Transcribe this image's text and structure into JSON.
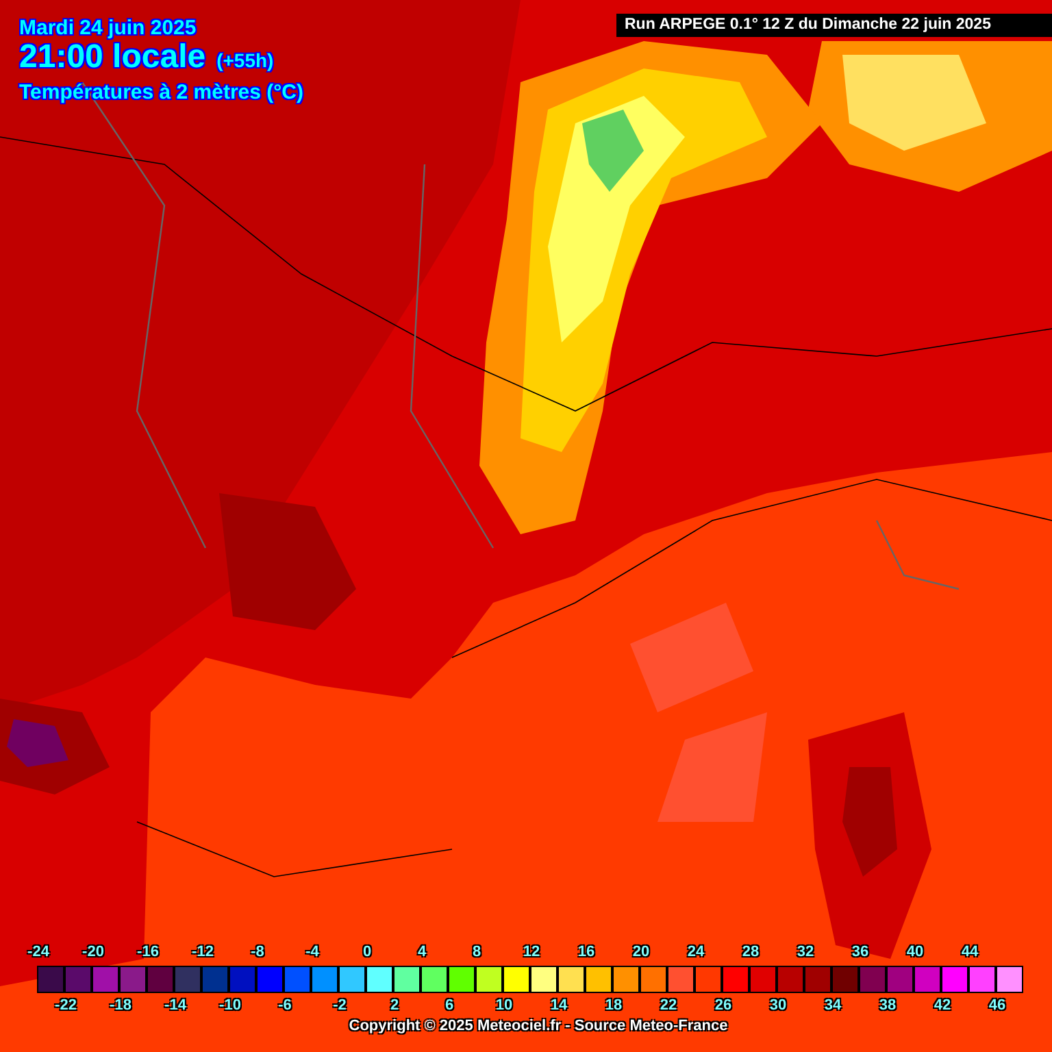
{
  "header": {
    "date": "Mardi 24 juin 2025",
    "time": "21:00 locale",
    "lead": "(+55h)",
    "field": "Températures à 2 mètres (°C)"
  },
  "run_banner": "Run ARPEGE 0.1° 12 Z du Dimanche 22 juin 2025",
  "legend": [
    {
      "label": "-24",
      "color": "#3a0a4a"
    },
    {
      "label": "-22",
      "color": "#5a0a6a"
    },
    {
      "label": "-20",
      "color": "#a010a8"
    },
    {
      "label": "-18",
      "color": "#8a1a8a"
    },
    {
      "label": "-16",
      "color": "#600040"
    },
    {
      "label": "-14",
      "color": "#303060"
    },
    {
      "label": "-12",
      "color": "#003090"
    },
    {
      "label": "-10",
      "color": "#0010c0"
    },
    {
      "label": "-8",
      "color": "#0000ff"
    },
    {
      "label": "-6",
      "color": "#0050ff"
    },
    {
      "label": "-4",
      "color": "#0090ff"
    },
    {
      "label": "-2",
      "color": "#30c8ff"
    },
    {
      "label": "0",
      "color": "#60ffff"
    },
    {
      "label": "2",
      "color": "#60ffa0"
    },
    {
      "label": "4",
      "color": "#60ff60"
    },
    {
      "label": "6",
      "color": "#60ff00"
    },
    {
      "label": "8",
      "color": "#c0ff20"
    },
    {
      "label": "10",
      "color": "#ffff00"
    },
    {
      "label": "12",
      "color": "#ffff80"
    },
    {
      "label": "14",
      "color": "#ffe050"
    },
    {
      "label": "16",
      "color": "#ffc000"
    },
    {
      "label": "18",
      "color": "#ff9000"
    },
    {
      "label": "20",
      "color": "#ff7000"
    },
    {
      "label": "22",
      "color": "#ff5030"
    },
    {
      "label": "24",
      "color": "#ff3800"
    },
    {
      "label": "26",
      "color": "#ff0000"
    },
    {
      "label": "28",
      "color": "#e00000"
    },
    {
      "label": "30",
      "color": "#b80000"
    },
    {
      "label": "32",
      "color": "#a00000"
    },
    {
      "label": "34",
      "color": "#700000"
    },
    {
      "label": "36",
      "color": "#800050"
    },
    {
      "label": "38",
      "color": "#a00080"
    },
    {
      "label": "40",
      "color": "#d000c0"
    },
    {
      "label": "42",
      "color": "#ff00ff"
    },
    {
      "label": "44",
      "color": "#ff40ff"
    },
    {
      "label": "46",
      "color": "#ff90ff"
    }
  ],
  "copyright": "Copyright © 2025 Meteociel.fr - Source Meteo-France"
}
